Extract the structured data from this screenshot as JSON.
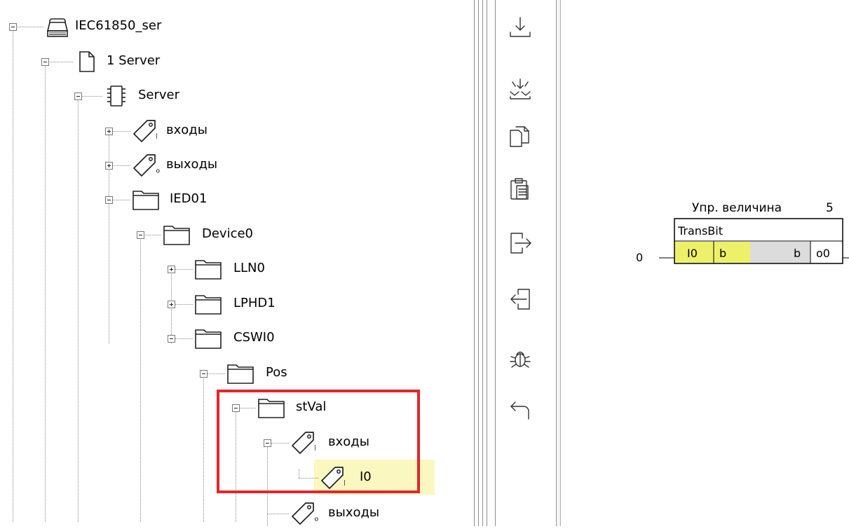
{
  "tree": {
    "nodes": [
      {
        "label": "IEC61850_ser",
        "icon": "database-icon",
        "expander": "minus"
      },
      {
        "label": "1 Server",
        "icon": "document-icon",
        "expander": "minus"
      },
      {
        "label": "Server",
        "icon": "chip-icon",
        "expander": "minus"
      },
      {
        "label": "входы",
        "icon": "tag-input-icon",
        "expander": "plus"
      },
      {
        "label": "выходы",
        "icon": "tag-output-icon",
        "expander": "plus"
      },
      {
        "label": "IED01",
        "icon": "folder-icon",
        "expander": "minus"
      },
      {
        "label": "Device0",
        "icon": "folder-icon",
        "expander": "minus"
      },
      {
        "label": "LLN0",
        "icon": "folder-icon",
        "expander": "plus"
      },
      {
        "label": "LPHD1",
        "icon": "folder-icon",
        "expander": "plus"
      },
      {
        "label": "CSWI0",
        "icon": "folder-icon",
        "expander": "minus"
      },
      {
        "label": "Pos",
        "icon": "folder-icon",
        "expander": "minus"
      },
      {
        "label": "stVal",
        "icon": "folder-icon",
        "expander": "minus"
      },
      {
        "label": "входы",
        "icon": "tag-input-icon",
        "expander": "minus"
      },
      {
        "label": "I0",
        "icon": "tag-input-icon",
        "expander": "none",
        "selected": true
      },
      {
        "label": "выходы",
        "icon": "tag-output-icon",
        "expander": "none"
      }
    ],
    "tag_input_marker": "I",
    "tag_output_marker": "O"
  },
  "toolbar": {
    "buttons": [
      {
        "name": "download-icon"
      },
      {
        "name": "download-merge-icon"
      },
      {
        "name": "copy-icon"
      },
      {
        "name": "paste-icon"
      },
      {
        "name": "export-icon"
      },
      {
        "name": "import-icon"
      },
      {
        "name": "debug-bug-icon"
      },
      {
        "name": "undo-icon"
      }
    ]
  },
  "block": {
    "header_label": "Упр. величина",
    "header_value": "5",
    "title": "TransBit",
    "input_value": "0",
    "input_pin": "I0",
    "input_type": "b",
    "output_type": "b",
    "output_pin": "o0"
  },
  "colors": {
    "selection": "#fbf7c0",
    "highlight_box": "#e3262b",
    "pin_yellow": "#eef06a",
    "block_body": "#dcdcdc"
  }
}
